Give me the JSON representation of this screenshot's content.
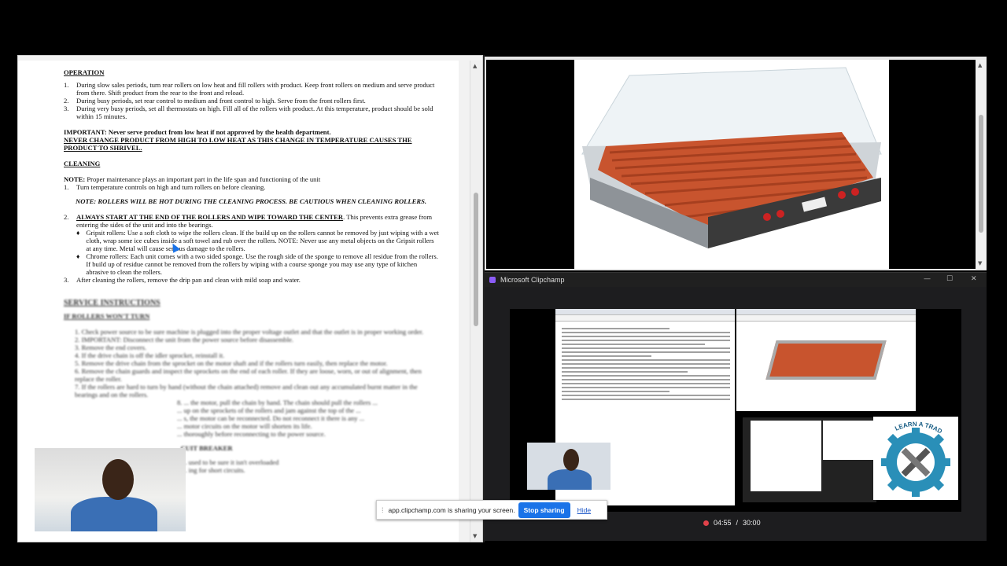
{
  "document": {
    "operation_heading": "OPERATION",
    "operation_items": [
      {
        "num": "1.",
        "text": "During slow sales periods, turn rear rollers on low heat and fill rollers with product. Keep front rollers on medium and serve product from there. Shift product from the rear to the front and reload."
      },
      {
        "num": "2.",
        "text": "During busy periods, set rear control to medium and front control to high. Serve from the front rollers first."
      },
      {
        "num": "3.",
        "text": "During very busy periods, set all thermostats on high. Fill all of the rollers with product. At this temperature, product should be sold within 15 minutes."
      }
    ],
    "important_line": "IMPORTANT: Never serve product from low heat if not approved by the health department.",
    "never_change_line": "NEVER CHANGE PRODUCT FROM HIGH TO LOW HEAT AS THIS CHANGE IN TEMPERATURE CAUSES THE PRODUCT TO SHRIVEL.",
    "cleaning_heading": "CLEANING",
    "note_label": "NOTE:",
    "note_text": " Proper maintenance plays an important part in the life span and functioning of the unit",
    "cleaning_item1_num": "1.",
    "cleaning_item1": "Turn temperature controls on high and turn rollers on before cleaning.",
    "hot_note": "NOTE: ROLLERS WILL BE HOT DURING THE CLEANING PROCESS. BE CAUTIOUS WHEN CLEANING ROLLERS.",
    "cleaning_item2_num": "2.",
    "cleaning_item2_bold": "ALWAYS START AT THE END OF THE ROLLERS AND WIPE TOWARD THE CENTER",
    "cleaning_item2_rest": ". This prevents extra grease from entering the sides of the unit and into the bearings.",
    "bullets": [
      "Gripsit rollers: Use a soft cloth to wipe the rollers clean. If the build up on the rollers cannot be removed by just wiping with a wet cloth, wrap some ice cubes inside a soft towel and rub over the rollers. NOTE: Never use any metal objects on the Gripsit rollers at any time. Metal will cause serious damage to the rollers.",
      "Chrome rollers: Each unit comes with a two sided sponge. Use the rough side of the sponge to remove all residue from the rollers. If build up of residue cannot be removed from the rollers by wiping with a course sponge you may use any type of kitchen abrasive to clean the rollers."
    ],
    "bullet_glyph": "♦",
    "cleaning_item3_num": "3.",
    "cleaning_item3": "After cleaning the rollers, remove the drip pan and clean with mild soap and water.",
    "service_heading": "SERVICE INSTRUCTIONS",
    "service_subheading": "IF ROLLERS WON'T TURN",
    "service_items": [
      "1. Check power source to be sure machine is plugged into the proper voltage outlet and that the outlet is in proper working order.",
      "2. IMPORTANT: Disconnect the unit from the power source before disassemble.",
      "3. Remove the end covers.",
      "4. If the drive chain is off the idler sprocket, reinstall it.",
      "5. Remove the drive chain from the sprocket on the motor shaft and if the rollers turn easily, then replace the motor.",
      "6. Remove the chain guards and inspect the sprockets on the end of each roller. If they are loose, worn, or out of alignment, then replace the roller.",
      "7. If the rollers are hard to turn by hand (without the chain attached) remove and clean out any accumulated burnt matter in the bearings and on the rollers.",
      "8. ... the motor, pull the chain by hand. The chain should pull the rollers ...",
      "... up on the sprockets of the rollers and jam against the top of the ...",
      "... s, the motor can be reconnected. Do not reconnect it there is any ...",
      "... motor circuits on the motor will shorten its life.",
      "... thoroughly before reconnecting to the power source."
    ],
    "breaker_heading": "... CUIT BREAKER",
    "breaker_lines": [
      "... used to be sure it isn't overloaded",
      "... ing for short circuits."
    ]
  },
  "clipchamp": {
    "window_title": "Microsoft Clipchamp",
    "minimize": "—",
    "maximize": "☐",
    "close": "✕",
    "elapsed": "04:55",
    "separator": "/",
    "total": "30:00",
    "logo_text": "LEARN A TRADE"
  },
  "share_bar": {
    "message": "app.clipchamp.com is sharing your screen.",
    "stop_label": "Stop sharing",
    "hide_label": "Hide"
  },
  "colors": {
    "accent": "#1a73e8",
    "record": "#e0424a",
    "clipchamp_brand": "#8b5cf6"
  }
}
